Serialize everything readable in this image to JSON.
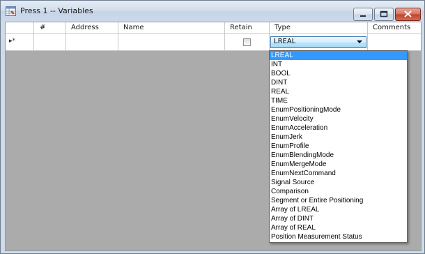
{
  "window": {
    "title": "Press 1 -- Variables",
    "controls": {
      "minimize": "minimize",
      "maximize": "maximize",
      "close": "close"
    }
  },
  "grid": {
    "columns": [
      "#",
      "Address",
      "Name",
      "Retain",
      "Type",
      "Comments"
    ],
    "new_row": {
      "indicator": "▸*",
      "number": "",
      "address": "",
      "name": "",
      "retain": false,
      "type": "LREAL",
      "comments": ""
    }
  },
  "type_dropdown": {
    "selected": "LREAL",
    "options": [
      "LREAL",
      "INT",
      "BOOL",
      "DINT",
      "REAL",
      "TIME",
      "EnumPositioningMode",
      "EnumVelocity",
      "EnumAcceleration",
      "EnumJerk",
      "EnumProfile",
      "EnumBlendingMode",
      "EnumMergeMode",
      "EnumNextCommand",
      "Signal Source",
      "Comparison",
      "Segment or Entire Positioning",
      "Array of LREAL",
      "Array of DINT",
      "Array of REAL",
      "Position Measurement Status"
    ]
  }
}
